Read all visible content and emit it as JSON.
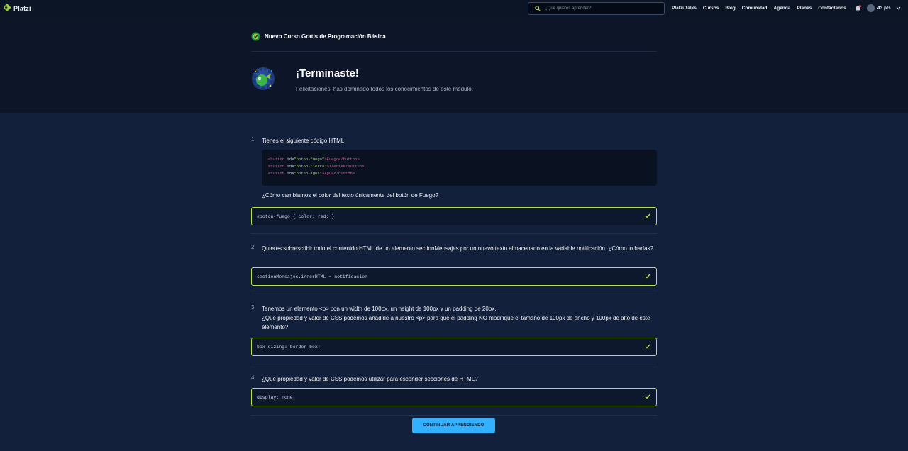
{
  "brand": {
    "name": "Platzi"
  },
  "search": {
    "placeholder": "¿Qué quieres aprender?"
  },
  "nav": {
    "links": [
      "Platzi Talks",
      "Cursos",
      "Blog",
      "Comunidad",
      "Agenda",
      "Planes",
      "Contáctanos"
    ]
  },
  "user": {
    "points": "43 pts"
  },
  "course": {
    "title": "Nuevo Curso Gratis de Programación Básica"
  },
  "result": {
    "title": "¡Terminaste!",
    "subtitle": "Felicitaciones, has dominado todos los conocimientos de este módulo."
  },
  "questions": [
    {
      "number": "1.",
      "text": "Tienes el siguiente código HTML:",
      "code": [
        [
          "<button",
          " id=",
          "\"boton-fuego\"",
          ">Fuego</button>"
        ],
        [
          "<button",
          " id=",
          "\"boton-tierra\"",
          ">Tierra</button>"
        ],
        [
          "<button",
          " id=",
          "\"boton-agua\"",
          ">Agua</button>"
        ]
      ],
      "follow_up": "¿Cómo cambiamos el color del texto únicamente del botón de Fuego?",
      "answer": "#boton-fuego { color: red; }"
    },
    {
      "number": "2.",
      "text": "Quieres sobrescribir todo el contenido HTML de un elemento sectionMensajes por un nuevo texto almacenado en la variable notificación. ¿Cómo lo harías?",
      "answer": "sectionMensajes.innerHTML = notificacion"
    },
    {
      "number": "3.",
      "text_line1": "Tenemos un elemento <p> con un width de 100px, un height de 100px y un padding de 20px.",
      "text_line2": "¿Qué propiedad y valor de CSS podemos añadirle a nuestro <p> para que el padding NO modifique el tamaño de 100px de ancho y 100px de alto de este elemento?",
      "answer": "box-sizing: border-box;"
    },
    {
      "number": "4.",
      "text": "¿Qué propiedad y valor de CSS podemos utilizar para esconder secciones de HTML?",
      "answer": "display: none;"
    }
  ],
  "cta": {
    "label": "CONTINUAR APRENDIENDO"
  },
  "colors": {
    "accent": "#33b1ff",
    "correct_border": "#b7e04a",
    "brand_green": "#98ca3f",
    "background": "#13203b"
  }
}
